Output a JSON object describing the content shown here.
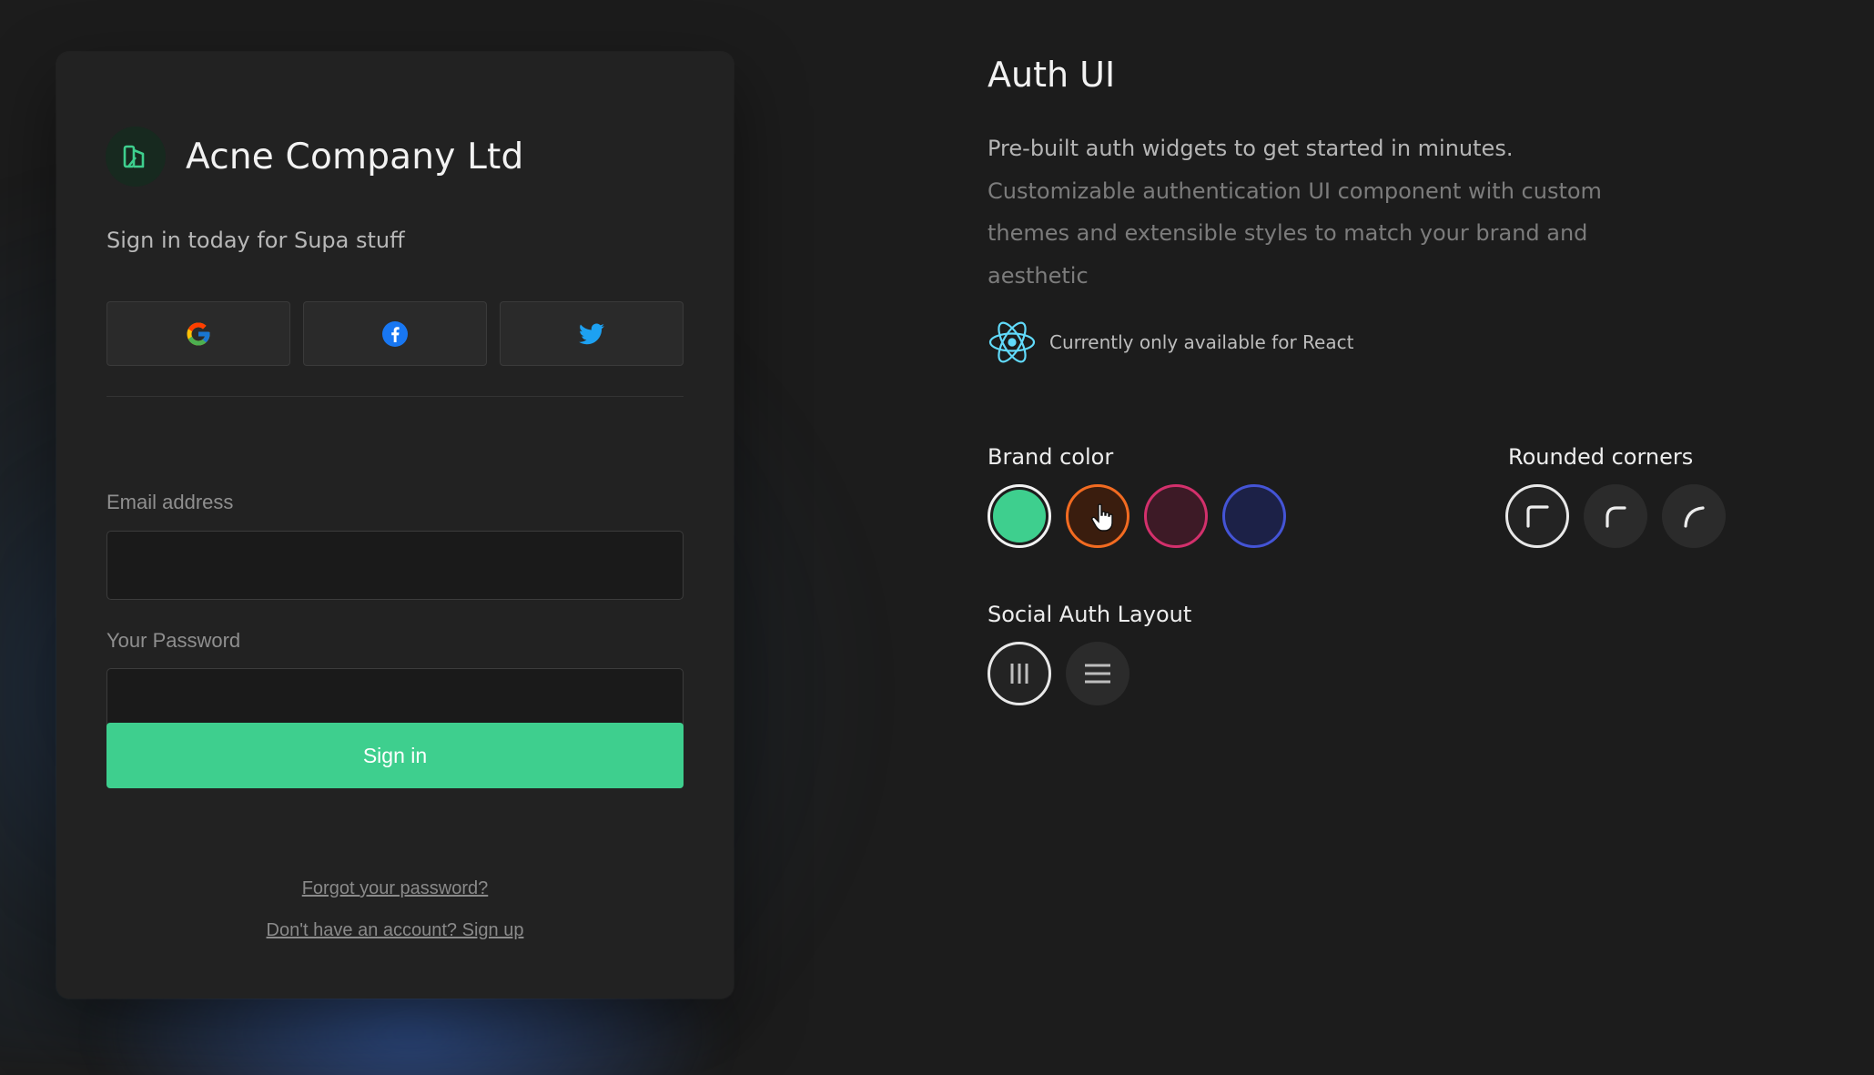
{
  "login_card": {
    "company_name": "Acne Company Ltd",
    "subtitle": "Sign in today for Supa stuff",
    "social_buttons": [
      {
        "icon": "google-icon"
      },
      {
        "icon": "facebook-icon"
      },
      {
        "icon": "twitter-icon"
      }
    ],
    "email": {
      "label": "Email address",
      "value": "",
      "placeholder": ""
    },
    "password": {
      "label": "Your Password",
      "value": "",
      "placeholder": ""
    },
    "sign_in_label": "Sign in",
    "forgot_link": "Forgot your password?",
    "signup_link": "Don't have an account? Sign up"
  },
  "info": {
    "title": "Auth UI",
    "lead_line_1": "Pre-built auth widgets to get started in minutes.",
    "lead_line_2": "Customizable authentication UI component with custom themes and extensible styles to match your brand and aesthetic",
    "react_note": "Currently only available for React"
  },
  "brand_color": {
    "label": "Brand color",
    "swatches": [
      {
        "name": "green",
        "color": "#3ecf8e",
        "ring": "#f2f2f2",
        "selected": true
      },
      {
        "name": "orange",
        "color": "#3a1d0e",
        "ring": "#f26b21",
        "selected": false
      },
      {
        "name": "pink",
        "color": "#3d1a26",
        "ring": "#d3306c",
        "selected": false
      },
      {
        "name": "blue",
        "color": "#1c2147",
        "ring": "#4454d6",
        "selected": false
      }
    ]
  },
  "rounded_corners": {
    "label": "Rounded corners",
    "options": [
      {
        "name": "small-radius",
        "selected": true
      },
      {
        "name": "medium-radius",
        "selected": false
      },
      {
        "name": "large-radius",
        "selected": false
      }
    ]
  },
  "social_layout": {
    "label": "Social Auth Layout",
    "options": [
      {
        "name": "horizontal-columns",
        "icon": "columns-icon",
        "selected": true
      },
      {
        "name": "vertical-rows",
        "icon": "menu-lines-icon",
        "selected": false
      }
    ]
  },
  "colors": {
    "accent": "#3ecf8e",
    "background": "#1c1c1c",
    "card": "#222222"
  }
}
